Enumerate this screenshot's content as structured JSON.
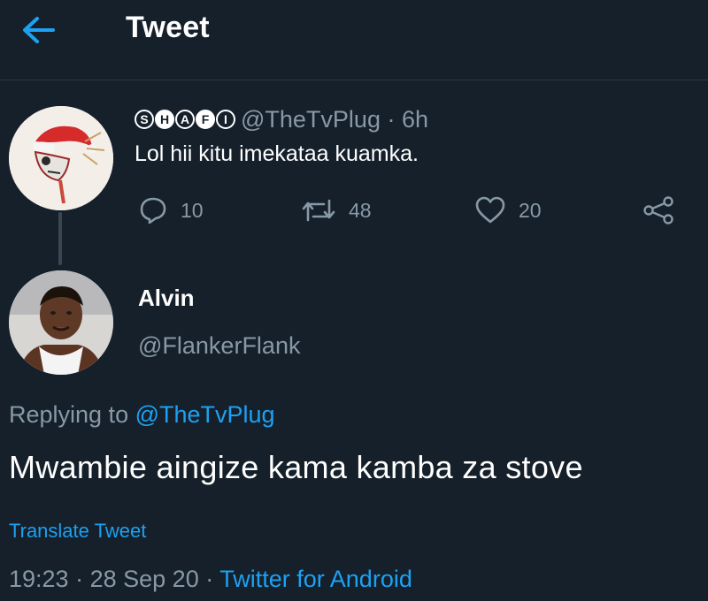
{
  "header": {
    "title": "Tweet"
  },
  "original_tweet": {
    "display_name_letters": [
      "S",
      "H",
      "A",
      "F",
      "I"
    ],
    "handle_time": "@TheTvPlug · 6h",
    "text": "Lol hii kitu imekataa kuamka.",
    "replies": "10",
    "retweets": "48",
    "likes": "20"
  },
  "reply_tweet": {
    "name": "Alvin",
    "handle": "@FlankerFlank",
    "replying_prefix": "Replying to ",
    "replying_handle": "@TheTvPlug",
    "text": "Mwambie aingize kama kamba za stove",
    "translate_label": "Translate Tweet",
    "time": "19:23",
    "date": "28 Sep 20",
    "source": "Twitter for Android"
  },
  "colors": {
    "background": "#15202b",
    "accent": "#1da1f2",
    "muted": "#8899a6"
  }
}
